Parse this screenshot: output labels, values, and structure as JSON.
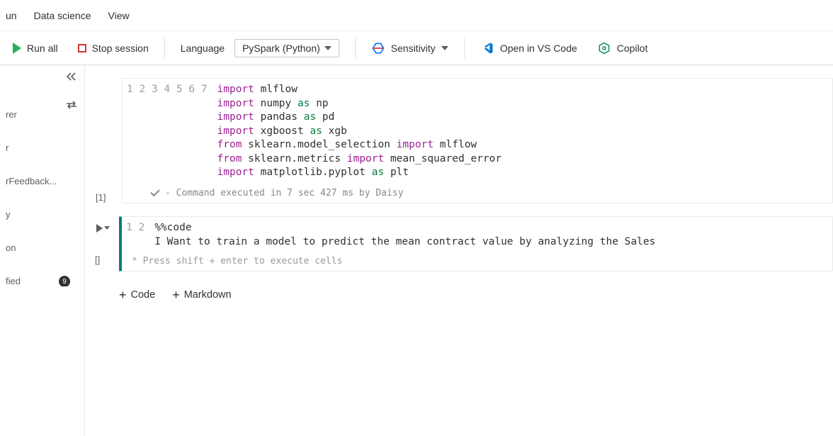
{
  "topbar": {
    "items": [
      "un",
      "Data science",
      "View"
    ]
  },
  "toolbar": {
    "run_all": "Run all",
    "stop_session": "Stop session",
    "language_label": "Language",
    "language_value": "PySpark (Python)",
    "sensitivity": "Sensitivity",
    "open_vscode": "Open in VS Code",
    "copilot": "Copilot"
  },
  "sidebar": {
    "items": [
      "rer",
      "r",
      "rFeedback...",
      "y",
      "on",
      "fied"
    ],
    "badge_count": "9"
  },
  "cells": [
    {
      "exec_label": "[1]",
      "lines": [
        [
          {
            "t": "import ",
            "c": "kw"
          },
          {
            "t": "mlflow"
          }
        ],
        [
          {
            "t": "import ",
            "c": "kw"
          },
          {
            "t": "numpy "
          },
          {
            "t": "as ",
            "c": "kw2"
          },
          {
            "t": "np"
          }
        ],
        [
          {
            "t": "import ",
            "c": "kw"
          },
          {
            "t": "pandas "
          },
          {
            "t": "as ",
            "c": "kw2"
          },
          {
            "t": "pd"
          }
        ],
        [
          {
            "t": "import ",
            "c": "kw"
          },
          {
            "t": "xgboost "
          },
          {
            "t": "as ",
            "c": "kw2"
          },
          {
            "t": "xgb"
          }
        ],
        [
          {
            "t": "from ",
            "c": "kw"
          },
          {
            "t": "sklearn.model_selection "
          },
          {
            "t": "import ",
            "c": "kw"
          },
          {
            "t": "mlflow"
          }
        ],
        [
          {
            "t": "from ",
            "c": "kw"
          },
          {
            "t": "sklearn.metrics "
          },
          {
            "t": "import ",
            "c": "kw"
          },
          {
            "t": "mean_squared_error"
          }
        ],
        [
          {
            "t": "import ",
            "c": "kw"
          },
          {
            "t": "matplotlib.pyplot "
          },
          {
            "t": "as ",
            "c": "kw2"
          },
          {
            "t": "plt"
          }
        ]
      ],
      "status": "- Command executed in 7 sec 427 ms by Daisy"
    },
    {
      "exec_label": "[]",
      "lines": [
        [
          {
            "t": "%%code"
          }
        ],
        [
          {
            "t": "I Want to train a model to predict the mean contract value by analyzing the Sales"
          }
        ]
      ],
      "hint": "*  Press shift + enter to execute cells"
    }
  ],
  "add": {
    "code": "Code",
    "markdown": "Markdown"
  }
}
